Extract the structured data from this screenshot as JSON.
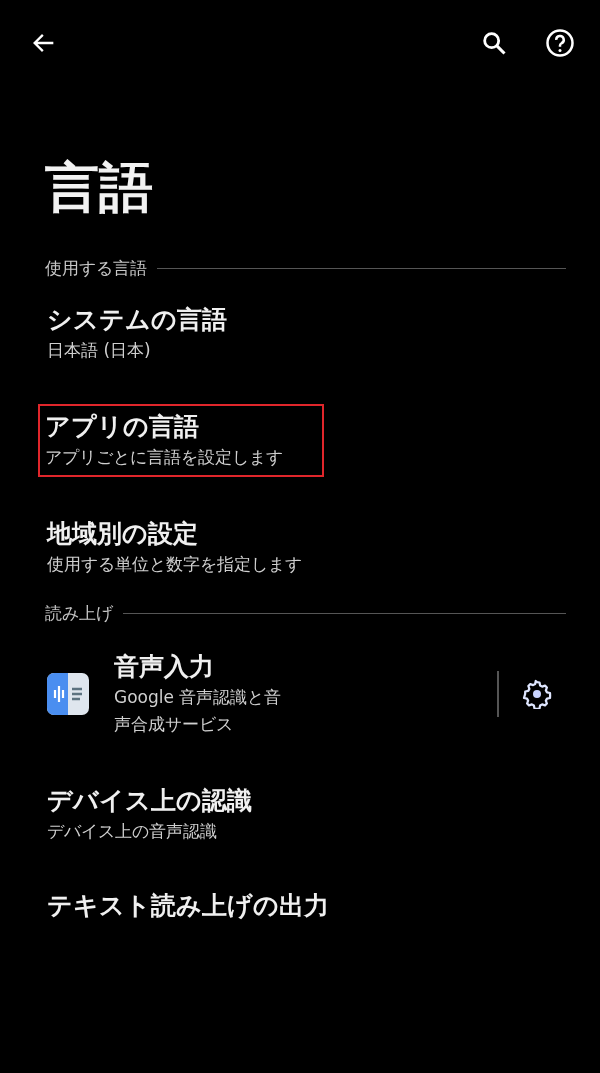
{
  "title": "言語",
  "sections": [
    {
      "heading": "使用する言語",
      "items": [
        {
          "kind": "text",
          "title": "システムの言語",
          "subtitle": "日本語 (日本)",
          "highlighted": false
        },
        {
          "kind": "text",
          "title": "アプリの言語",
          "subtitle": "アプリごとに言語を設定します",
          "highlighted": true
        },
        {
          "kind": "text",
          "title": "地域別の設定",
          "subtitle": "使用する単位と数字を指定します",
          "highlighted": false
        }
      ]
    },
    {
      "heading": "読み上げ",
      "items": [
        {
          "kind": "app",
          "title": "音声入力",
          "subtitle": "Google 音声認識と音声合成サービス",
          "highlighted": false
        },
        {
          "kind": "text",
          "title": "デバイス上の認識",
          "subtitle": "デバイス上の音声認識",
          "highlighted": false
        },
        {
          "kind": "text",
          "title": "テキスト読み上げの出力",
          "highlighted": false
        }
      ]
    }
  ]
}
